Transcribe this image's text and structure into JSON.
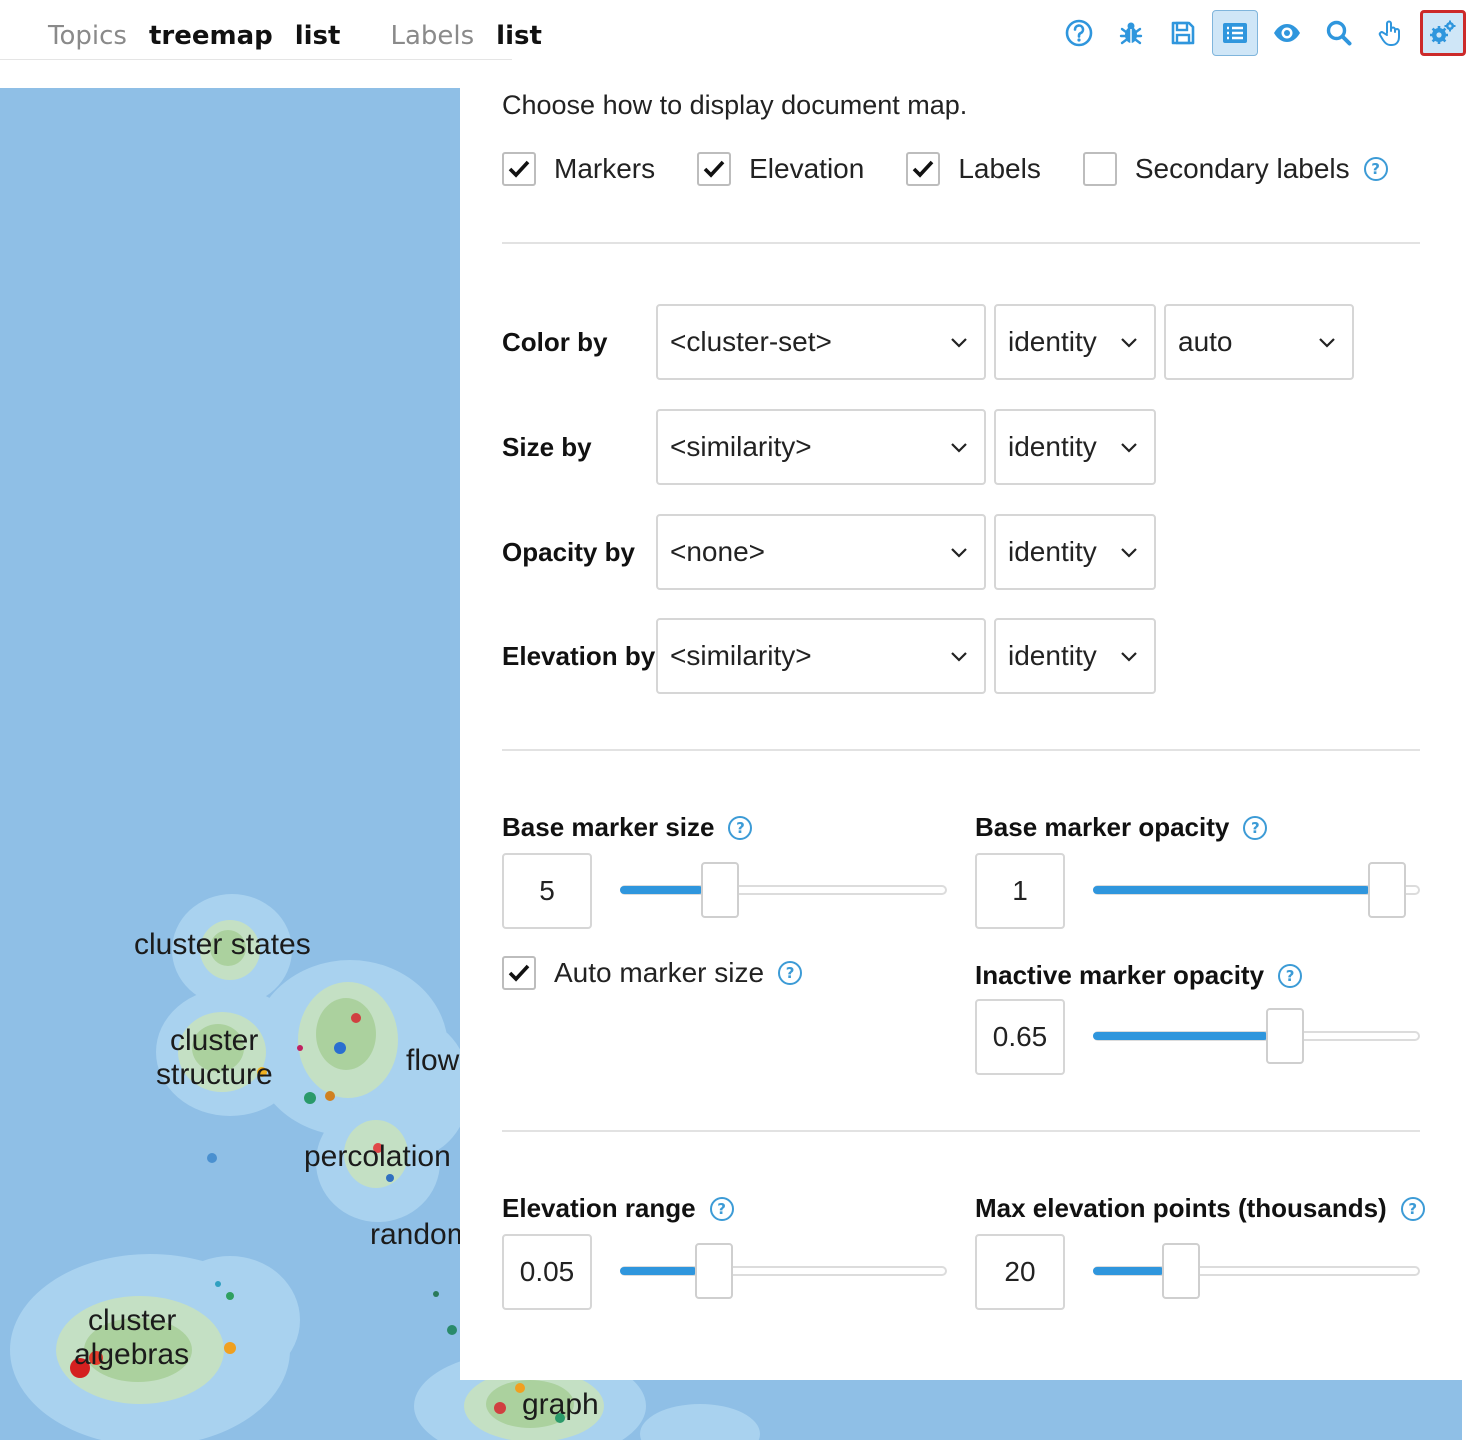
{
  "nav": {
    "topics_label": "Topics",
    "topics_treemap": "treemap",
    "topics_list": "list",
    "labels_label": "Labels",
    "labels_list": "list"
  },
  "toolbar": {
    "icons": [
      "help-icon",
      "bug-icon",
      "save-icon",
      "list-icon",
      "eye-icon",
      "search-icon",
      "hand-pointer-icon",
      "settings-icon"
    ],
    "accent_color": "#2f96dd",
    "active_bg": "#cfe6f7",
    "selected_border": "#cc2a2a"
  },
  "map": {
    "background": "#8fbfe6",
    "labels": [
      "cluster states",
      "cluster",
      "structure",
      "flow",
      "percolation",
      "random",
      "cluster",
      "algebras",
      "graph"
    ]
  },
  "panel": {
    "intro": "Choose how to display document map.",
    "checkboxes": [
      {
        "label": "Markers",
        "checked": true
      },
      {
        "label": "Elevation",
        "checked": true
      },
      {
        "label": "Labels",
        "checked": true
      },
      {
        "label": "Secondary labels",
        "checked": false
      }
    ],
    "color_by": {
      "label": "Color by",
      "field": "<cluster-set>",
      "transform": "identity",
      "palette": "auto"
    },
    "size_by": {
      "label": "Size by",
      "field": "<similarity>",
      "transform": "identity"
    },
    "opacity_by": {
      "label": "Opacity by",
      "field": "<none>",
      "transform": "identity"
    },
    "elevation_by": {
      "label": "Elevation by",
      "field": "<similarity>",
      "transform": "identity"
    },
    "base_marker_size": {
      "label": "Base marker size",
      "value": "5",
      "fraction": 0.28
    },
    "base_marker_opacity": {
      "label": "Base marker opacity",
      "value": "1",
      "fraction": 0.95
    },
    "auto_marker_size": {
      "label": "Auto marker size",
      "checked": true
    },
    "inactive_marker_opacity": {
      "label": "Inactive marker opacity",
      "value": "0.65",
      "fraction": 0.6
    },
    "elevation_range": {
      "label": "Elevation range",
      "value": "0.05",
      "fraction": 0.26
    },
    "max_elevation_points": {
      "label": "Max elevation points (thousands)",
      "value": "20",
      "fraction": 0.24
    }
  }
}
